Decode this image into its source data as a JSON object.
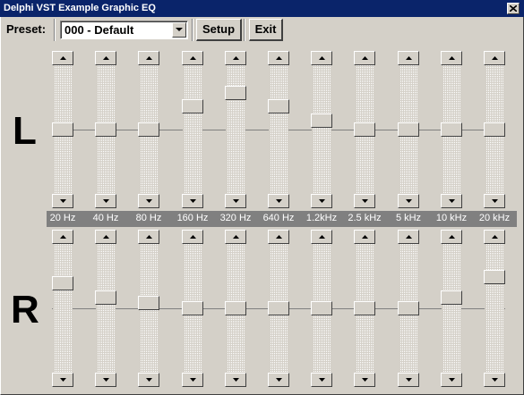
{
  "window": {
    "title": "Delphi VST Example Graphic EQ"
  },
  "toolbar": {
    "preset_label": "Preset:",
    "preset_value": "000 - Default",
    "setup_label": "Setup",
    "exit_label": "Exit"
  },
  "channels": {
    "left_label": "L",
    "right_label": "R"
  },
  "frequencies": [
    "20 Hz",
    "40 Hz",
    "80 Hz",
    "160 Hz",
    "320 Hz",
    "640 Hz",
    "1.2kHz",
    "2.5 kHz",
    "5 kHz",
    "10 kHz",
    "20 kHz"
  ],
  "left_levels": [
    0.5,
    0.5,
    0.5,
    0.7,
    0.82,
    0.7,
    0.58,
    0.5,
    0.5,
    0.5,
    0.5
  ],
  "right_levels": [
    0.72,
    0.59,
    0.55,
    0.5,
    0.5,
    0.5,
    0.5,
    0.5,
    0.5,
    0.59,
    0.77
  ],
  "colors": {
    "titlebar": "#0a246a",
    "face": "#d4d0c8",
    "freqbar": "#808080"
  }
}
